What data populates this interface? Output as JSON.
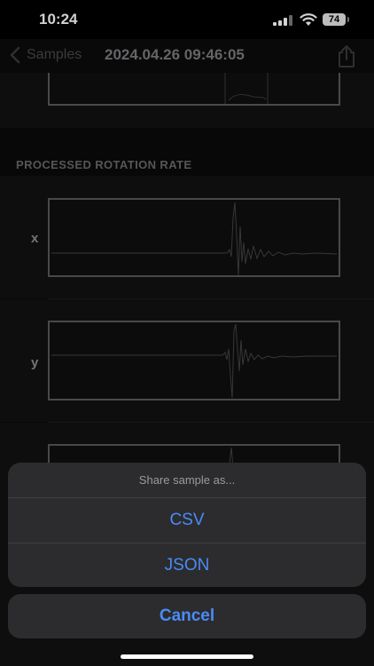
{
  "status_bar": {
    "time": "10:24",
    "battery": "74"
  },
  "nav": {
    "back_label": "Samples",
    "title": "2024.04.26 09:46:05"
  },
  "section": {
    "header": "PROCESSED ROTATION RATE"
  },
  "plots": [
    {
      "axis": "x"
    },
    {
      "axis": "y"
    }
  ],
  "action_sheet": {
    "title": "Share sample as...",
    "options": [
      "CSV",
      "JSON"
    ],
    "cancel": "Cancel"
  },
  "colors": {
    "accent": "#4a8bf5",
    "sheet_bg": "#2c2c2e"
  }
}
